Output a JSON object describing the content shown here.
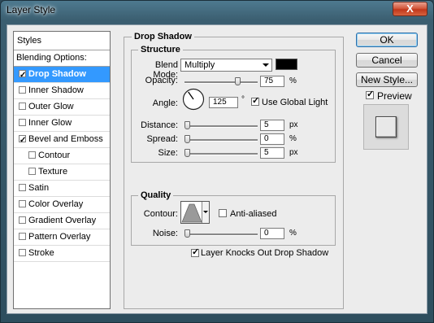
{
  "window": {
    "title": "Layer Style",
    "close_glyph": "X"
  },
  "left_panel": {
    "header": "Styles",
    "blending_options": "Blending Options: Custom",
    "items": [
      {
        "label": "Drop Shadow",
        "checked": true,
        "selected": true,
        "indent": false
      },
      {
        "label": "Inner Shadow",
        "checked": false,
        "selected": false,
        "indent": false
      },
      {
        "label": "Outer Glow",
        "checked": false,
        "selected": false,
        "indent": false
      },
      {
        "label": "Inner Glow",
        "checked": false,
        "selected": false,
        "indent": false
      },
      {
        "label": "Bevel and Emboss",
        "checked": true,
        "selected": false,
        "indent": false
      },
      {
        "label": "Contour",
        "checked": false,
        "selected": false,
        "indent": true
      },
      {
        "label": "Texture",
        "checked": false,
        "selected": false,
        "indent": true
      },
      {
        "label": "Satin",
        "checked": false,
        "selected": false,
        "indent": false
      },
      {
        "label": "Color Overlay",
        "checked": false,
        "selected": false,
        "indent": false
      },
      {
        "label": "Gradient Overlay",
        "checked": false,
        "selected": false,
        "indent": false
      },
      {
        "label": "Pattern Overlay",
        "checked": false,
        "selected": false,
        "indent": false
      },
      {
        "label": "Stroke",
        "checked": false,
        "selected": false,
        "indent": false
      }
    ]
  },
  "drop_shadow": {
    "section_title": "Drop Shadow",
    "structure": {
      "title": "Structure",
      "blend_mode_label": "Blend Mode:",
      "blend_mode_value": "Multiply",
      "shadow_color": "#000000",
      "opacity_label": "Opacity:",
      "opacity_value": "75",
      "opacity_unit": "%",
      "opacity_fraction": 0.75,
      "angle_label": "Angle:",
      "angle_value": "125",
      "angle_unit": "°",
      "angle_degrees": 125,
      "use_global_light_label": "Use Global Light",
      "use_global_light_checked": true,
      "distance_label": "Distance:",
      "distance_value": "5",
      "distance_unit": "px",
      "spread_label": "Spread:",
      "spread_value": "0",
      "spread_unit": "%",
      "size_label": "Size:",
      "size_value": "5",
      "size_unit": "px"
    },
    "quality": {
      "title": "Quality",
      "contour_label": "Contour:",
      "anti_aliased_label": "Anti-aliased",
      "anti_aliased_checked": false,
      "noise_label": "Noise:",
      "noise_value": "0",
      "noise_unit": "%"
    },
    "knocks_out_label": "Layer Knocks Out Drop Shadow",
    "knocks_out_checked": true
  },
  "buttons": {
    "ok": "OK",
    "cancel": "Cancel",
    "new_style": "New Style..."
  },
  "preview": {
    "label": "Preview",
    "checked": true
  }
}
